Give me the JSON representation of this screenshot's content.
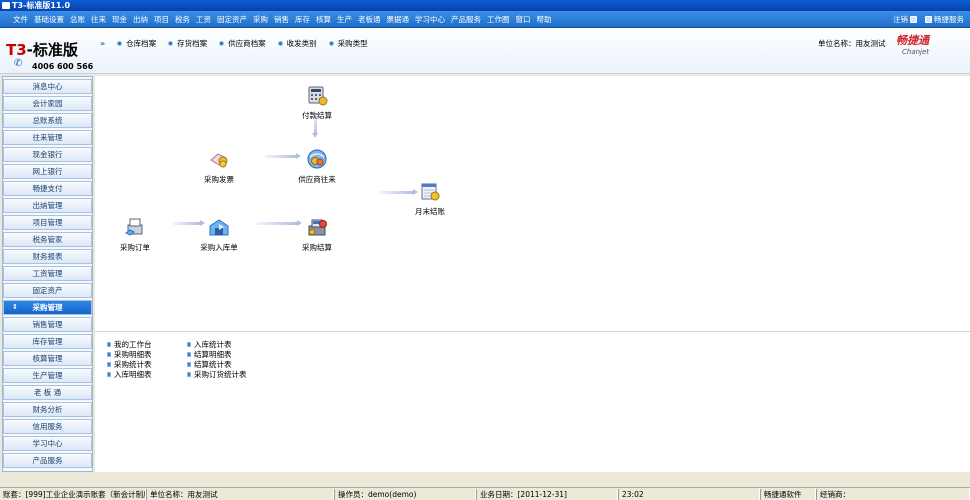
{
  "window": {
    "title": "T3-标准版11.0"
  },
  "menubar": {
    "items": [
      "文件",
      "基础设置",
      "总账",
      "往来",
      "现金",
      "出纳",
      "项目",
      "税务",
      "工资",
      "固定资产",
      "采购",
      "销售",
      "库存",
      "核算",
      "生产",
      "老板通",
      "票据通",
      "学习中心",
      "产品服务",
      "工作圈",
      "窗口",
      "帮助"
    ],
    "right": {
      "logout": "注销",
      "chanjet_service": "畅捷服务"
    }
  },
  "header": {
    "logo": {
      "prefix": "T3",
      "suffix": "-标准版",
      "phone": "4006 600 566"
    },
    "quicknav": [
      "仓库档案",
      "存货档案",
      "供应商档案",
      "收发类别",
      "采购类型"
    ],
    "unit_name": "单位名称：用友测试",
    "brand": {
      "cn": "畅捷通",
      "en": "Chanjet"
    }
  },
  "sidebar": {
    "items": [
      "消息中心",
      "会计家园",
      "总账系统",
      "往来管理",
      "现金银行",
      "网上银行",
      "畅捷支付",
      "出纳管理",
      "项目管理",
      "税务管家",
      "财务报表",
      "工资管理",
      "固定资产",
      "采购管理",
      "销售管理",
      "库存管理",
      "核算管理",
      "生产管理",
      "老 板 通",
      "财务分析",
      "信用服务",
      "学习中心",
      "产品服务"
    ],
    "active_index": 13
  },
  "flow": {
    "payment_settlement": "付款结算",
    "purchase_invoice": "采购发票",
    "supplier_account": "供应商往来",
    "month_end": "月末结账",
    "purchase_order": "采购订单",
    "purchase_receipt": "采购入库单",
    "purchase_settlement": "采购结算"
  },
  "reports": {
    "col1": [
      "我的工作台",
      "采购明细表",
      "采购统计表",
      "入库明细表"
    ],
    "col2": [
      "入库统计表",
      "结算明细表",
      "结算统计表",
      "采购订货统计表"
    ]
  },
  "statusbar": {
    "account": "账套：[999]工业企业演示账套（新会计制度）",
    "unit": "单位名称：用友测试",
    "operator": "操作员：demo(demo)",
    "business_date": "业务日期：[2011-12-31]",
    "time": "23:02",
    "software": "畅捷通软件",
    "dealer": "经销商："
  }
}
